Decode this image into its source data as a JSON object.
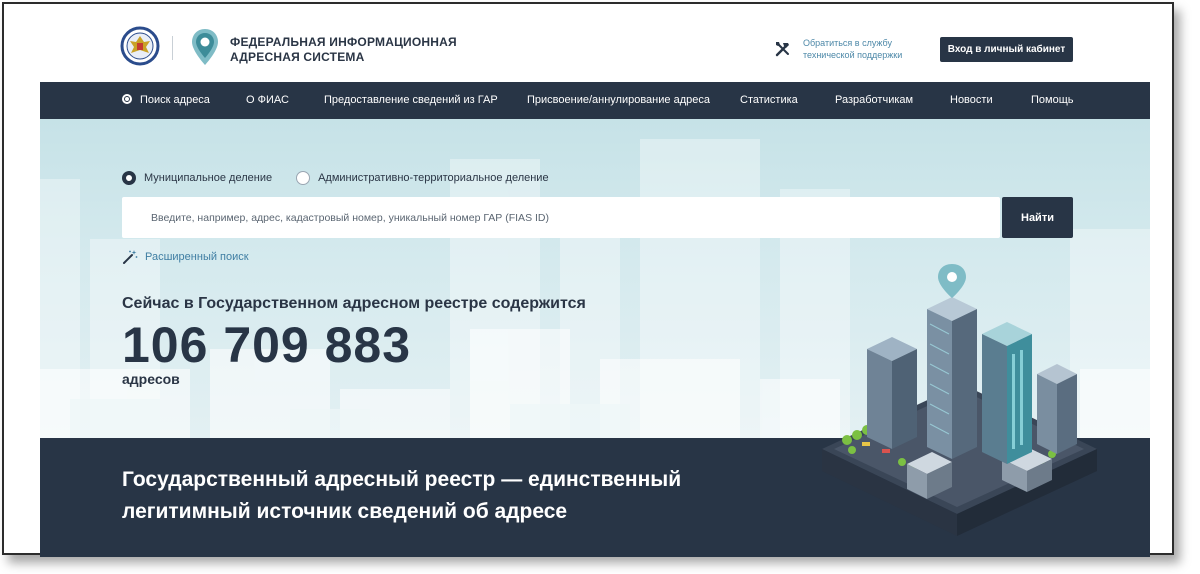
{
  "header": {
    "title_line1": "ФЕДЕРАЛЬНАЯ ИНФОРМАЦИОННАЯ",
    "title_line2": "АДРЕСНАЯ СИСТЕМА",
    "support_line1": "Обратиться в службу",
    "support_line2": "технической поддержки",
    "login_label": "Вход в личный кабинет"
  },
  "nav": {
    "items": [
      {
        "label": "Поиск адреса",
        "active": true
      },
      {
        "label": "О ФИАС"
      },
      {
        "label": "Предоставление сведений из ГАР"
      },
      {
        "label": "Присвоение/аннулирование адреса"
      },
      {
        "label": "Статистика"
      },
      {
        "label": "Разработчикам"
      },
      {
        "label": "Новости"
      },
      {
        "label": "Помощь"
      }
    ]
  },
  "search": {
    "mode_municipal": "Муниципальное деление",
    "mode_admin": "Административно-территориальное деление",
    "selected_mode": "Муниципальное деление",
    "placeholder": "Введите, например, адрес, кадастровый номер, уникальный номер ГАР (FIAS ID)",
    "value": "",
    "find_label": "Найти",
    "advanced_label": "Расширенный поиск"
  },
  "stats": {
    "caption": "Сейчас в Государственном адресном реестре содержится",
    "count": "106 709 883",
    "unit": "адресов"
  },
  "banner": {
    "line1": "Государственный адресный реестр — единственный",
    "line2": "легитимный источник сведений об адресе"
  },
  "icons": {
    "emblem": "fns-emblem-icon",
    "logo": "map-pin-logo-icon",
    "support": "tools-icon",
    "advanced": "magic-wand-icon"
  },
  "colors": {
    "dark": "#283546",
    "accent": "#4d88a8",
    "hero_bg": "#d5eaee"
  }
}
